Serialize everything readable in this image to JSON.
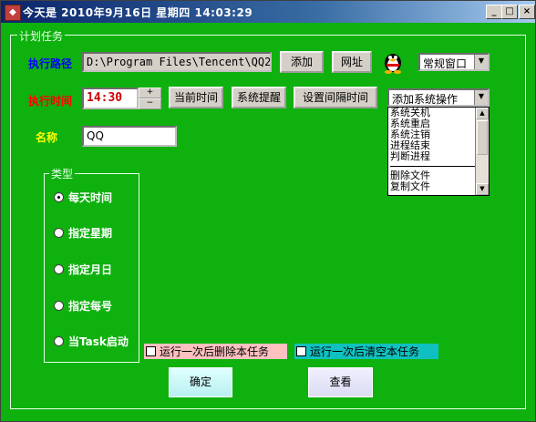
{
  "window": {
    "title": "今天是  2010年9月16日  星期四  14:03:29",
    "controls": {
      "minimize": "_",
      "maximize": "□",
      "close": "×"
    }
  },
  "group": {
    "label": "计划任务"
  },
  "path_row": {
    "label": "执行路径",
    "value": "D:\\Program Files\\Tencent\\QQ20",
    "add_label": "添加",
    "url_label": "网址",
    "window_mode": "常规窗口"
  },
  "time_row": {
    "label": "执行时间",
    "value": "14:30",
    "current_time_label": "当前时间",
    "system_reminder_label": "系统提醒",
    "set_interval_label": "设置间隔时间",
    "system_op_select": "添加系统操作",
    "system_ops": [
      "系统关机",
      "系统重启",
      "系统注销",
      "进程结束",
      "判断进程",
      "删除文件",
      "复制文件"
    ]
  },
  "name_row": {
    "label": "名称",
    "value": "QQ"
  },
  "type_group": {
    "label": "类型",
    "options": [
      "每天时间",
      "指定星期",
      "指定月日",
      "指定每号",
      "当Task启动"
    ],
    "selected": "每天时间"
  },
  "options": {
    "delete_after_run": "运行一次后删除本任务",
    "clear_after_run": "运行一次后清空本任务"
  },
  "actions": {
    "confirm": "确定",
    "view": "查看"
  },
  "colors": {
    "background": "#0fb10f",
    "path_label": "#0000ff",
    "time_label": "#ff0000",
    "name_label": "#ffff00",
    "time_value": "#cc0000"
  }
}
